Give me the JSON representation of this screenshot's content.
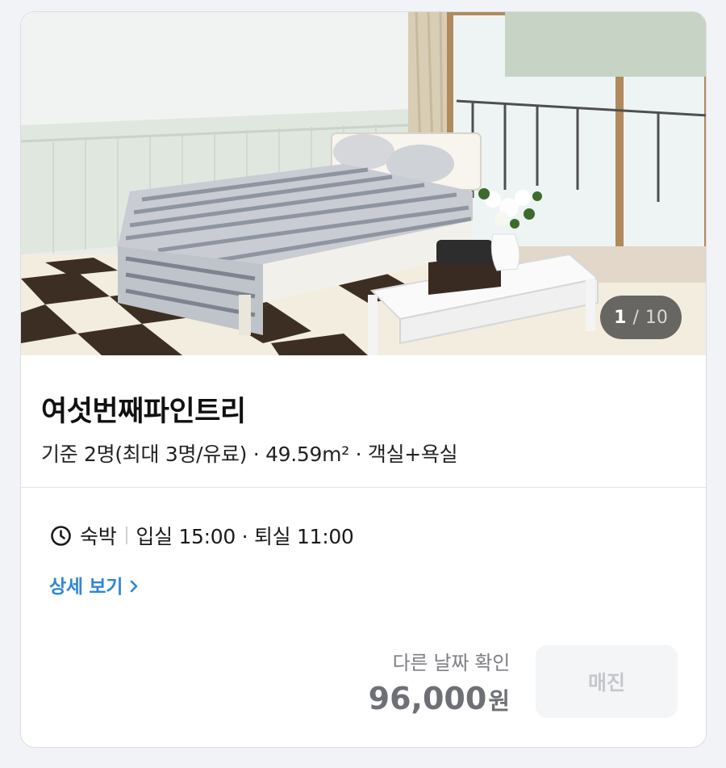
{
  "room": {
    "photo_counter": {
      "current": "1",
      "separator": "/",
      "total": "10"
    },
    "name": "여섯번째파인트리",
    "summary": "기준 2명(최대 3명/유료) · 49.59m² · 객실+욕실"
  },
  "stay": {
    "icon": "clock-icon",
    "type": "숙박",
    "times": "입실 15:00 · 퇴실 11:00"
  },
  "detail_link": {
    "label": "상세 보기",
    "icon": "chevron-right-icon"
  },
  "booking": {
    "other_date_label": "다른 날짜 확인",
    "price": "96,000",
    "currency": "원",
    "status_button": "매진"
  },
  "colors": {
    "link": "#2f86d8",
    "price": "#6f7075",
    "disabled_button_bg": "#f4f5f7",
    "disabled_button_text": "#c5c7cc"
  }
}
